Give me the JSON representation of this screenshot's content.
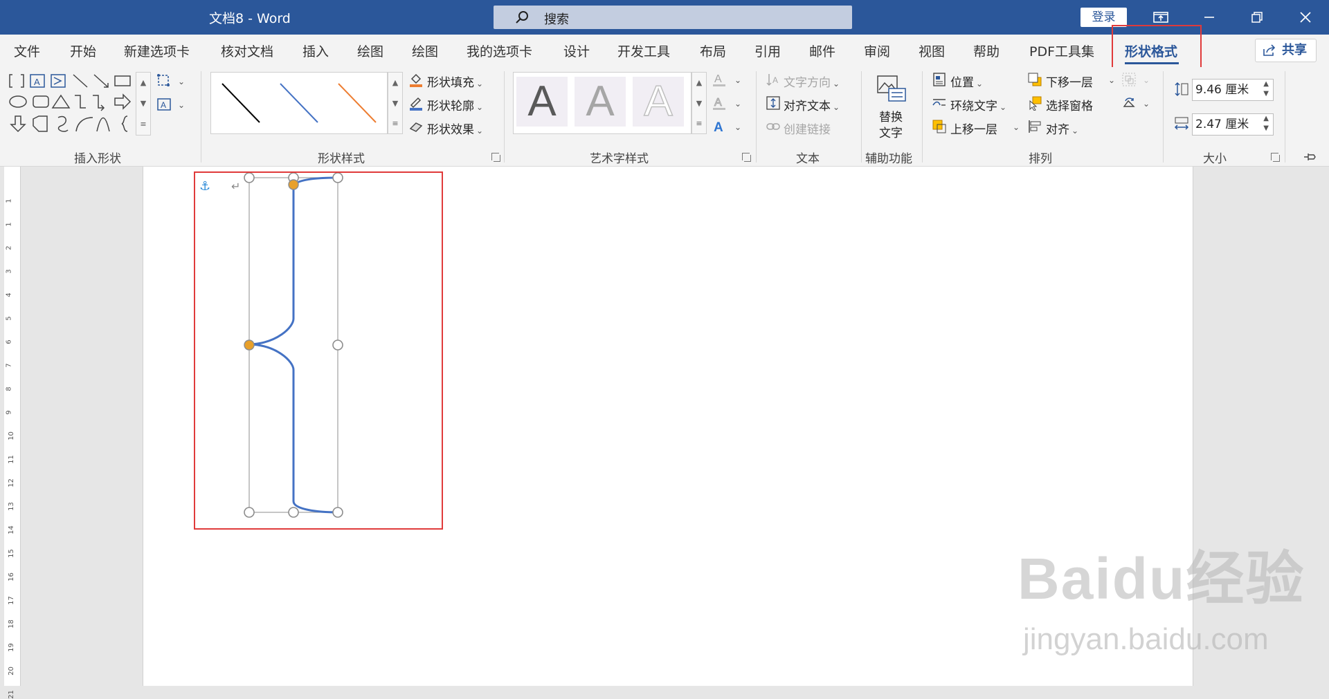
{
  "window": {
    "title": "文档8  -  Word",
    "search_placeholder": "搜索",
    "login": "登录"
  },
  "tabs": [
    "文件",
    "开始",
    "新建选项卡",
    "核对文档",
    "插入",
    "绘图",
    "绘图",
    "我的选项卡",
    "设计",
    "开发工具",
    "布局",
    "引用",
    "邮件",
    "审阅",
    "视图",
    "帮助",
    "PDF工具集",
    "形状格式"
  ],
  "active_tab": "形状格式",
  "share": "共享",
  "ribbon": {
    "insert_shapes": {
      "label": "插入形状"
    },
    "shape_styles": {
      "label": "形状样式",
      "fill": "形状填充",
      "outline": "形状轮廓",
      "effects": "形状效果"
    },
    "wordart_styles": {
      "label": "艺术字样式",
      "letter": "A"
    },
    "text": {
      "label": "文本",
      "direction": "文字方向",
      "align": "对齐文本",
      "link": "创建链接"
    },
    "accessibility": {
      "label": "辅助功能",
      "alt_text_line1": "替换",
      "alt_text_line2": "文字"
    },
    "arrange": {
      "label": "排列",
      "position": "位置",
      "wrap": "环绕文字",
      "bring_forward": "上移一层",
      "send_backward": "下移一层",
      "selection_pane": "选择窗格",
      "align": "对齐"
    },
    "size": {
      "label": "大小",
      "height": "9.46 厘米",
      "width": "2.47 厘米"
    }
  },
  "ruler_numbers": [
    "1",
    "1",
    "2",
    "3",
    "4",
    "5",
    "6",
    "7",
    "8",
    "9",
    "10",
    "11",
    "12",
    "13",
    "14",
    "15",
    "16",
    "17",
    "18",
    "19",
    "20",
    "21"
  ],
  "watermark": {
    "main": "Baidu经验",
    "sub": "jingyan.baidu.com"
  },
  "colors": {
    "accent": "#2b579a",
    "highlight": "#e03a3a",
    "handle_orange": "#e8a02a",
    "brace_blue": "#4472c4"
  }
}
